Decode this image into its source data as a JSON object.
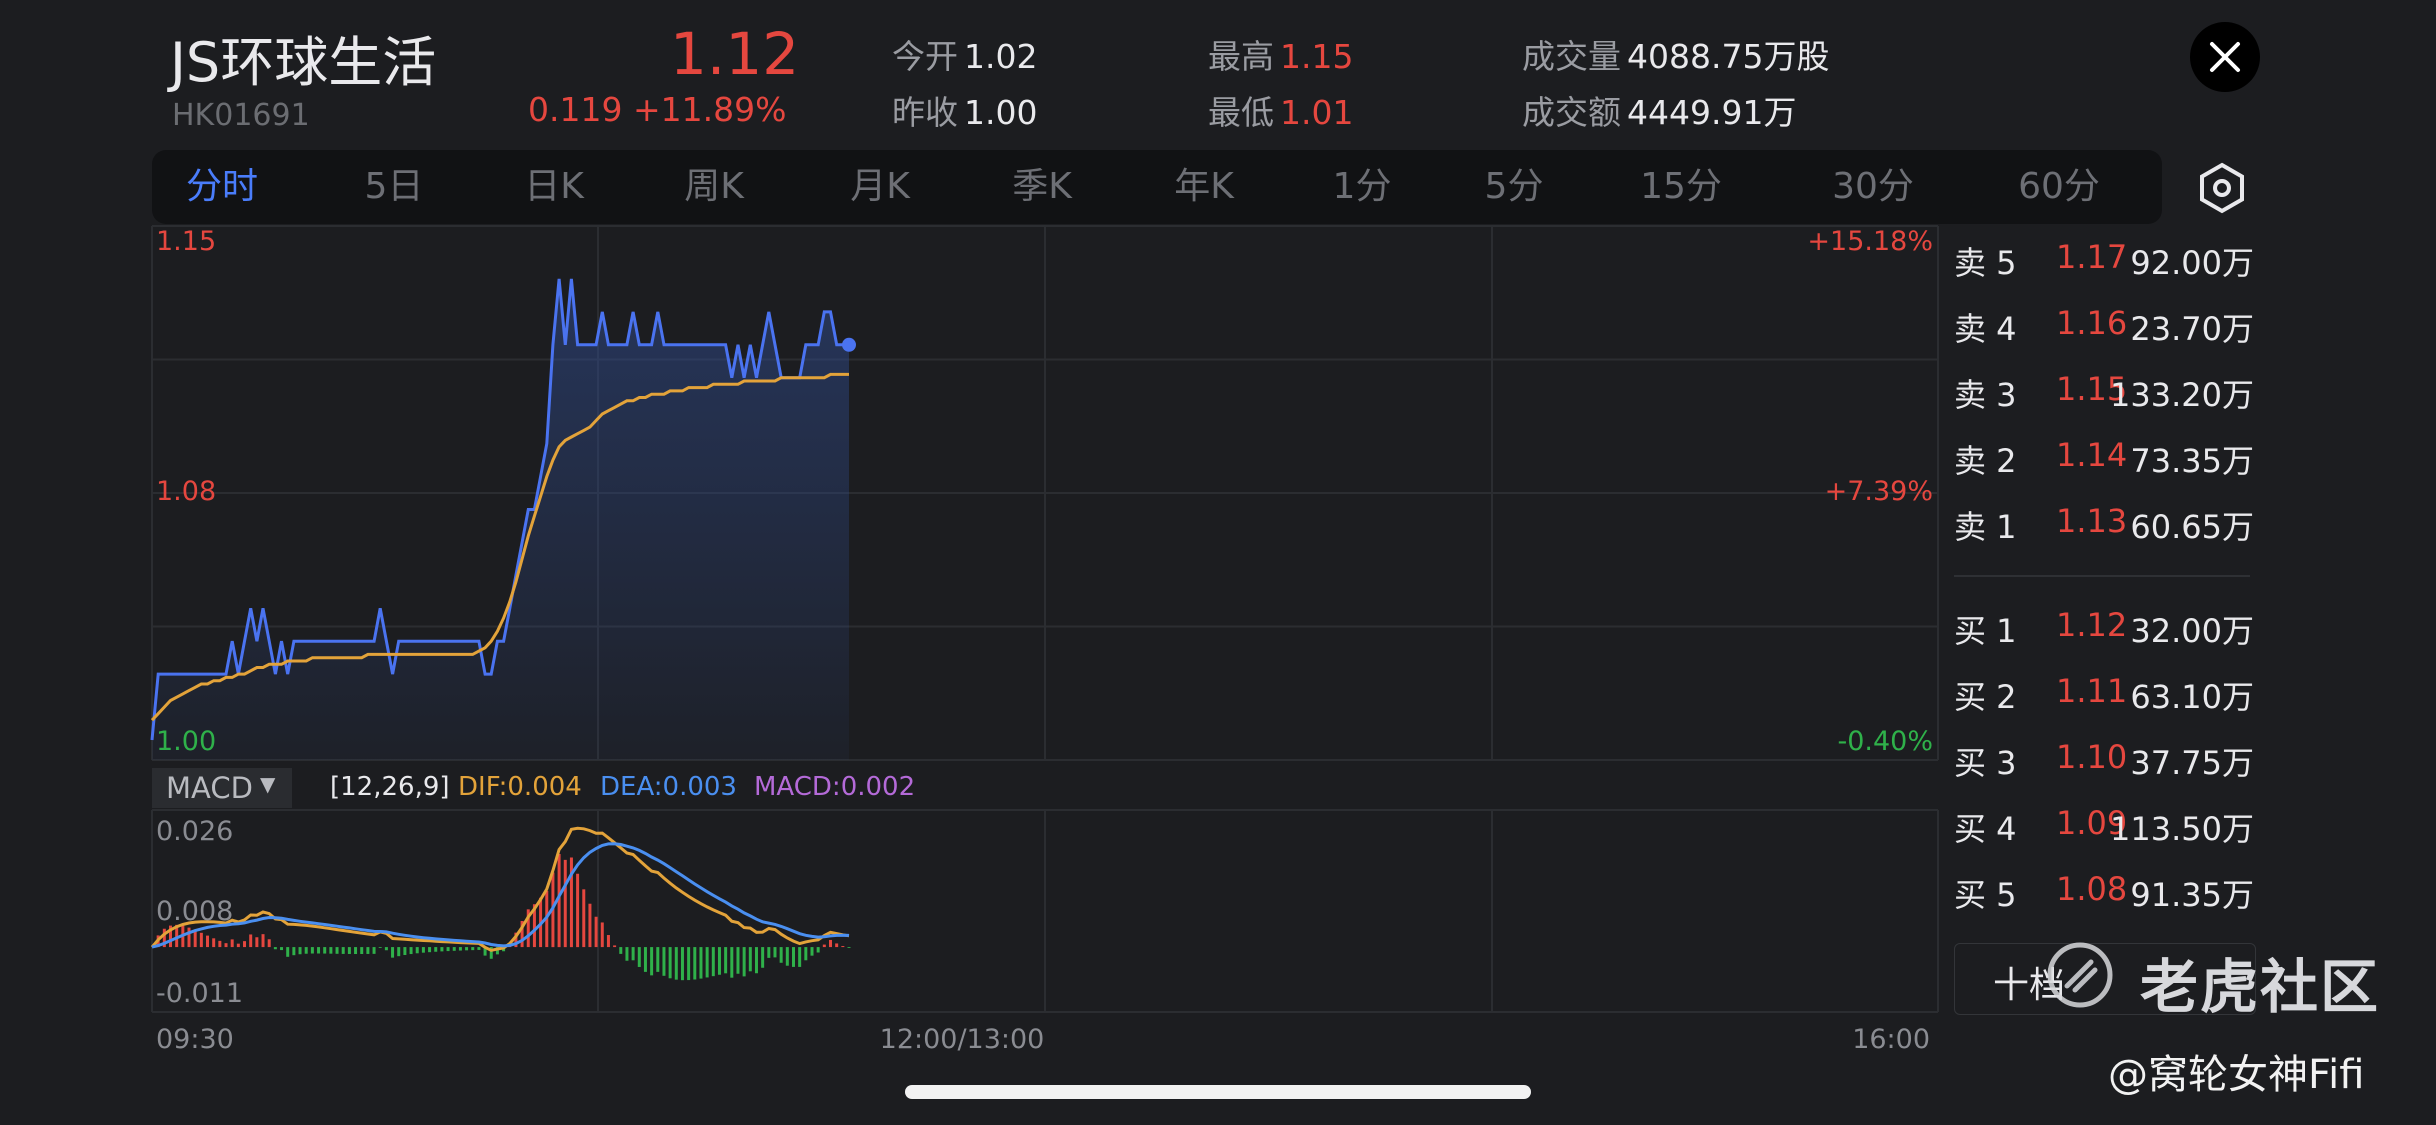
{
  "header": {
    "name": "JS环球生活",
    "code": "HK01691",
    "price": "1.12",
    "change": "0.119  +11.89%",
    "stats": {
      "open_label": "今开",
      "open": "1.02",
      "prev_close_label": "昨收",
      "prev_close": "1.00",
      "high_label": "最高",
      "high": "1.15",
      "low_label": "最低",
      "low": "1.01",
      "volume_label": "成交量",
      "volume": "4088.75万股",
      "turnover_label": "成交额",
      "turnover": "4449.91万"
    }
  },
  "tabs": [
    {
      "label": "分时",
      "active": true
    },
    {
      "label": "5日"
    },
    {
      "label": "日K"
    },
    {
      "label": "周K"
    },
    {
      "label": "月K"
    },
    {
      "label": "季K"
    },
    {
      "label": "年K"
    },
    {
      "label": "1分"
    },
    {
      "label": "5分"
    },
    {
      "label": "15分"
    },
    {
      "label": "30分"
    },
    {
      "label": "60分"
    }
  ],
  "chart": {
    "price_labels": {
      "top": "1.15",
      "mid": "1.08",
      "bottom": "1.00"
    },
    "pct_labels": {
      "top": "+15.18%",
      "mid": "+7.39%",
      "bottom": "-0.40%"
    },
    "time_labels": {
      "start": "09:30",
      "mid": "12:00/13:00",
      "end": "16:00"
    },
    "macd": {
      "indicator": "MACD",
      "params": "[12,26,9]",
      "dif": "DIF:0.004",
      "dea": "DEA:0.003",
      "macd": "MACD:0.002",
      "y_labels": {
        "top": "0.026",
        "mid": "0.008",
        "bottom": "-0.011"
      }
    }
  },
  "chart_data": {
    "type": "line",
    "price_axis": {
      "ylim": [
        1.0,
        1.15
      ]
    },
    "price_series": {
      "name": "price",
      "color": "#4a73f0",
      "values": [
        1.0,
        1.02,
        1.02,
        1.02,
        1.02,
        1.02,
        1.02,
        1.02,
        1.02,
        1.02,
        1.02,
        1.02,
        1.02,
        1.03,
        1.02,
        1.03,
        1.04,
        1.03,
        1.04,
        1.03,
        1.02,
        1.03,
        1.02,
        1.03,
        1.03,
        1.03,
        1.03,
        1.03,
        1.03,
        1.03,
        1.03,
        1.03,
        1.03,
        1.03,
        1.03,
        1.03,
        1.03,
        1.04,
        1.03,
        1.02,
        1.03,
        1.03,
        1.03,
        1.03,
        1.03,
        1.03,
        1.03,
        1.03,
        1.03,
        1.03,
        1.03,
        1.03,
        1.03,
        1.03,
        1.02,
        1.02,
        1.03,
        1.03,
        1.04,
        1.05,
        1.06,
        1.07,
        1.07,
        1.08,
        1.09,
        1.12,
        1.14,
        1.12,
        1.14,
        1.12,
        1.12,
        1.12,
        1.12,
        1.13,
        1.12,
        1.12,
        1.12,
        1.12,
        1.13,
        1.12,
        1.12,
        1.12,
        1.13,
        1.12,
        1.12,
        1.12,
        1.12,
        1.12,
        1.12,
        1.12,
        1.12,
        1.12,
        1.12,
        1.12,
        1.11,
        1.12,
        1.11,
        1.12,
        1.11,
        1.12,
        1.13,
        1.12,
        1.11,
        1.11,
        1.11,
        1.11,
        1.12,
        1.12,
        1.12,
        1.13,
        1.13,
        1.12,
        1.12,
        1.12
      ]
    },
    "avg_series": {
      "name": "avg",
      "color": "#e3a33a",
      "values": [
        1.006,
        1.008,
        1.01,
        1.012,
        1.013,
        1.014,
        1.015,
        1.016,
        1.017,
        1.017,
        1.018,
        1.018,
        1.019,
        1.019,
        1.02,
        1.02,
        1.021,
        1.022,
        1.022,
        1.023,
        1.023,
        1.023,
        1.024,
        1.024,
        1.024,
        1.024,
        1.025,
        1.025,
        1.025,
        1.025,
        1.025,
        1.025,
        1.025,
        1.025,
        1.025,
        1.026,
        1.026,
        1.026,
        1.026,
        1.026,
        1.026,
        1.026,
        1.026,
        1.026,
        1.026,
        1.026,
        1.026,
        1.026,
        1.026,
        1.026,
        1.026,
        1.026,
        1.026,
        1.027,
        1.028,
        1.03,
        1.033,
        1.037,
        1.042,
        1.048,
        1.055,
        1.062,
        1.068,
        1.074,
        1.08,
        1.085,
        1.089,
        1.091,
        1.092,
        1.093,
        1.094,
        1.095,
        1.097,
        1.099,
        1.1,
        1.101,
        1.102,
        1.103,
        1.103,
        1.104,
        1.104,
        1.105,
        1.105,
        1.105,
        1.106,
        1.106,
        1.106,
        1.107,
        1.107,
        1.107,
        1.107,
        1.108,
        1.108,
        1.108,
        1.108,
        1.108,
        1.109,
        1.109,
        1.109,
        1.109,
        1.109,
        1.109,
        1.11,
        1.11,
        1.11,
        1.11,
        1.11,
        1.11,
        1.11,
        1.11,
        1.111,
        1.111,
        1.111,
        1.111
      ]
    },
    "macd_axis": {
      "ylim": [
        -0.011,
        0.026
      ]
    },
    "dif_series": {
      "name": "DIF",
      "color": "#e3a33a"
    },
    "dea_series": {
      "name": "DEA",
      "color": "#4a8ff0"
    },
    "macd_bars": {
      "name": "MACD",
      "positive_color": "#e5473f",
      "negative_color": "#2fb14a"
    },
    "x_ticks": [
      "09:30",
      "12:00/13:00",
      "16:00"
    ]
  },
  "order_book": {
    "asks": [
      {
        "side": "卖 5",
        "price": "1.17",
        "volume": "92.00万"
      },
      {
        "side": "卖 4",
        "price": "1.16",
        "volume": "23.70万"
      },
      {
        "side": "卖 3",
        "price": "1.15",
        "volume": "133.20万"
      },
      {
        "side": "卖 2",
        "price": "1.14",
        "volume": "73.35万"
      },
      {
        "side": "卖 1",
        "price": "1.13",
        "volume": "60.65万"
      }
    ],
    "bids": [
      {
        "side": "买 1",
        "price": "1.12",
        "volume": "32.00万"
      },
      {
        "side": "买 2",
        "price": "1.11",
        "volume": "63.10万"
      },
      {
        "side": "买 3",
        "price": "1.10",
        "volume": "37.75万"
      },
      {
        "side": "买 4",
        "price": "1.09",
        "volume": "113.50万"
      },
      {
        "side": "买 5",
        "price": "1.08",
        "volume": "91.35万"
      }
    ],
    "ten_levels_label": "十档"
  },
  "watermark": {
    "brand": "老虎社区",
    "user": "@窝轮女神Fifi"
  }
}
